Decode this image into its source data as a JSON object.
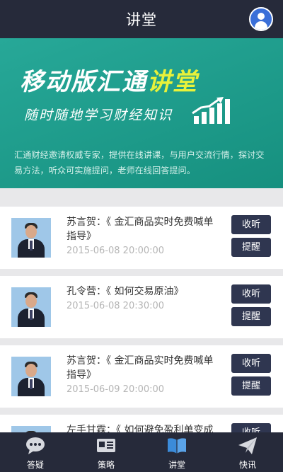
{
  "header": {
    "title": "讲堂"
  },
  "banner": {
    "title_prefix": "移动版汇通",
    "title_highlight": "讲堂",
    "subtitle": "随时随地学习财经知识",
    "description": "汇通财经邀请权威专家，提供在线讲课，与用户交流行情，探讨交易方法，听众可实施提问，老师在线回答提问。"
  },
  "lectures": [
    {
      "name": "苏言贺：《 金汇商品实时免费喊单指导》",
      "time": "2015-06-08 20:00:00",
      "listen_label": "收听",
      "remind_label": "提醒"
    },
    {
      "name": "孔令营：《 如何交易原油》",
      "time": "2015-06-08 20:30:00",
      "listen_label": "收听",
      "remind_label": "提醒"
    },
    {
      "name": "苏言贺：《 金汇商品实时免费喊单指导》",
      "time": "2015-06-09 20:00:00",
      "listen_label": "收听",
      "remind_label": "提醒"
    },
    {
      "name": "左手甘霖：《 如何避免盈利单变成",
      "time": "",
      "listen_label": "收听",
      "remind_label": ""
    }
  ],
  "tabbar": {
    "items": [
      {
        "label": "答疑",
        "icon": "chat-bubble-icon"
      },
      {
        "label": "策略",
        "icon": "strategy-card-icon"
      },
      {
        "label": "讲堂",
        "icon": "open-book-icon",
        "active": true
      },
      {
        "label": "快讯",
        "icon": "paper-plane-icon"
      }
    ]
  },
  "colors": {
    "header_bg": "#262a3a",
    "banner_bg": "#1b9c8a",
    "accent_yellow": "#e8f23a",
    "button_bg": "#2f3650",
    "active_tab": "#3b8bd9"
  }
}
